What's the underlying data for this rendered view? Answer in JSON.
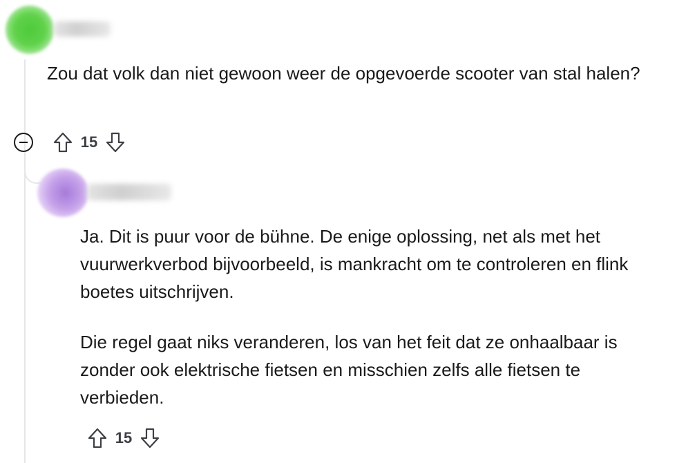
{
  "thread": {
    "comment": {
      "text": "Zou dat volk dan niet gewoon weer de opgevoerde scooter van stal halen?",
      "score": "15",
      "icons": {
        "collapse": "collapse-minus-icon",
        "upvote": "upvote-arrow-icon",
        "downvote": "downvote-arrow-icon"
      }
    },
    "reply": {
      "paragraphs": [
        "Ja. Dit is puur voor de bühne. De enige oplossing, net als met het vuurwerkverbod bijvoorbeeld, is mankracht om te controleren en flink boetes uitschrijven.",
        "Die regel gaat niks veranderen, los van het feit dat ze onhaalbaar is zonder ook elektrische fietsen en misschien zelfs alle fietsen te verbieden."
      ],
      "score": "15",
      "icons": {
        "upvote": "upvote-arrow-icon",
        "downvote": "downvote-arrow-icon"
      }
    }
  },
  "colors": {
    "text": "#1a1a1b",
    "thread_line": "#e5e7e9",
    "icon": "#3c3f44",
    "avatar_1": "#4fca3c",
    "avatar_2": "#a57ad9"
  }
}
